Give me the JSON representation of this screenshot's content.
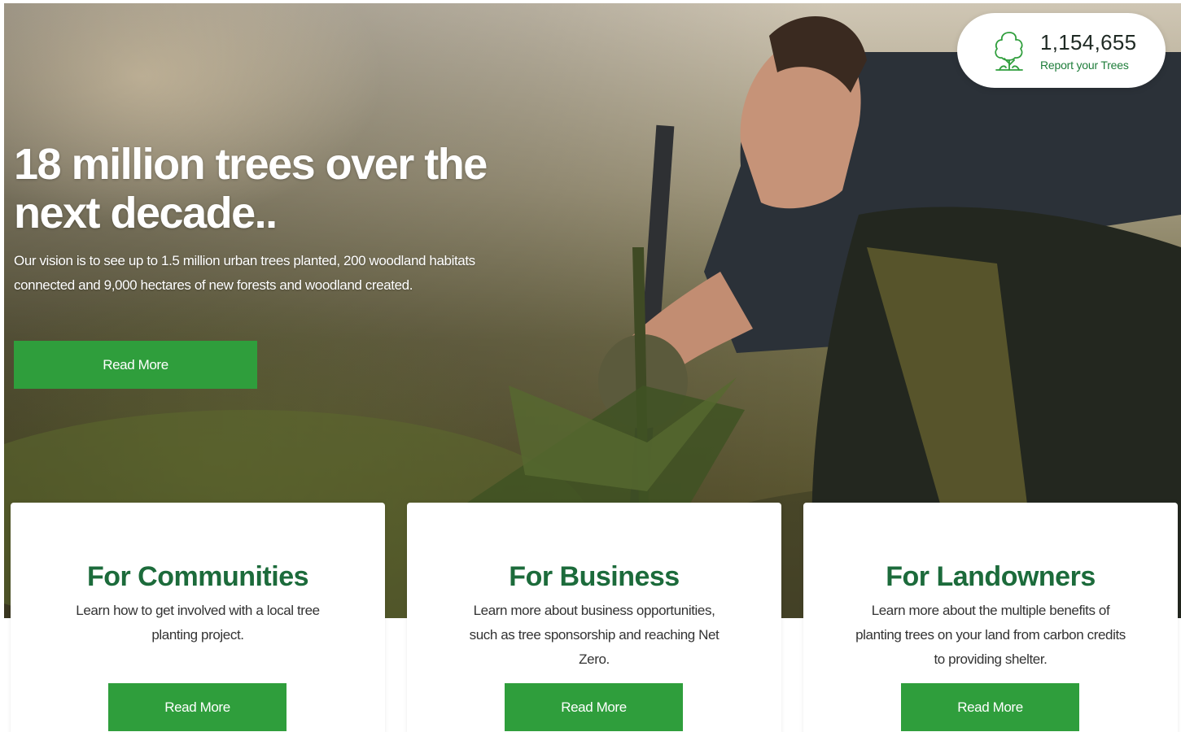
{
  "counter": {
    "value": "1,154,655",
    "link_label": "Report your Trees",
    "icon": "tree-icon"
  },
  "hero": {
    "title": "18 million trees over the next decade..",
    "description": "Our vision is to see up to 1.5 million urban trees planted, 200 woodland habitats connected and 9,000 hectares of new forests and woodland created.",
    "button_label": "Read More"
  },
  "cards": [
    {
      "title": "For Communities",
      "text": "Learn how to get involved with a local tree planting project.",
      "button_label": "Read More"
    },
    {
      "title": "For Business",
      "text": "Learn more about business opportunities, such as tree sponsorship and reaching Net Zero.",
      "button_label": "Read More"
    },
    {
      "title": "For Landowners",
      "text": "Learn more about the multiple benefits of planting trees on your land from carbon credits to providing shelter.",
      "button_label": "Read More"
    }
  ],
  "colors": {
    "accent_green": "#2f9e3c",
    "heading_green": "#1c6b3b",
    "link_green": "#1e7d3a"
  }
}
